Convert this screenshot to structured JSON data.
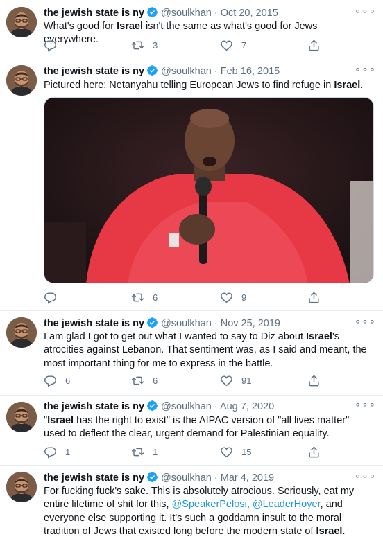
{
  "tweets": [
    {
      "name": "the jewish state is ny",
      "handle": "@soulkhan",
      "dot": "·",
      "date": "Oct 20, 2015",
      "text": {
        "t1": "What's good for ",
        "b1": "Israel",
        "t2": " isn't the same as what's good for Jews everywhere."
      },
      "replies": "",
      "retweets": "3",
      "likes": "7"
    },
    {
      "name": "the jewish state is ny",
      "handle": "@soulkhan",
      "dot": "·",
      "date": "Feb 16, 2015",
      "text": {
        "t1": "Pictured here: Netanyahu telling European Jews to find refuge in ",
        "b1": "Israel",
        "t2": "."
      },
      "replies": "",
      "retweets": "6",
      "likes": "9"
    },
    {
      "name": "the jewish state is ny",
      "handle": "@soulkhan",
      "dot": "·",
      "date": "Nov 25, 2019",
      "text": {
        "t1": "I am glad I got to get out what I wanted to say to Diz about ",
        "b1": "Israel",
        "t2": "'s atrocities against Lebanon. That sentiment was, as I said and meant, the most important thing for me to express in the battle."
      },
      "replies": "6",
      "retweets": "6",
      "likes": "91"
    },
    {
      "name": "the jewish state is ny",
      "handle": "@soulkhan",
      "dot": "·",
      "date": "Aug 7, 2020",
      "text": {
        "t0": "\"",
        "b1": "Israel",
        "t2": " has the right to exist\" is the AIPAC version of \"all lives matter\" used to deflect the clear, urgent demand for Palestinian equality."
      },
      "replies": "1",
      "retweets": "1",
      "likes": "15"
    },
    {
      "name": "the jewish state is ny",
      "handle": "@soulkhan",
      "dot": "·",
      "date": "Mar 4, 2019",
      "text": {
        "t1": "For fucking fuck's sake. This is absolutely atrocious. Seriously, eat my entire lifetime of shit for this, ",
        "m1": "@SpeakerPelosi",
        "t2": ", ",
        "m2": "@LeaderHoyer",
        "t3": ", and everyone else supporting it. It's such a goddamn insult to the moral tradition of Jews that existed long before the modern state of ",
        "b1": "Israel",
        "t4": "."
      }
    }
  ],
  "colors": {
    "accent": "#1b95e0",
    "muted": "#5b7083",
    "verified": "#1da1f2",
    "divider": "#e6ecf0"
  }
}
